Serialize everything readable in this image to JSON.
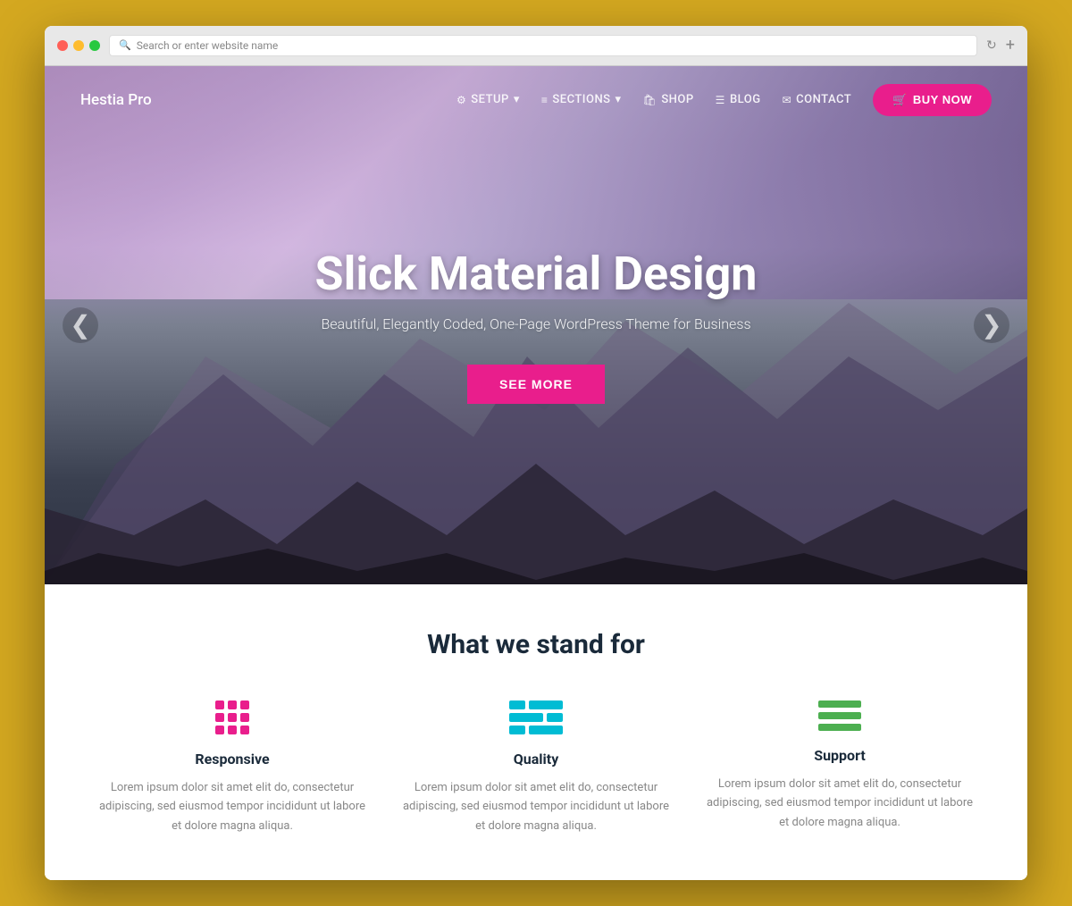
{
  "browser": {
    "address_placeholder": "Search or enter website name",
    "add_tab_label": "+"
  },
  "navbar": {
    "brand": "Hestia Pro",
    "nav_items": [
      {
        "id": "setup",
        "label": "SETUP",
        "icon": "⚙",
        "has_dropdown": true
      },
      {
        "id": "sections",
        "label": "SECTIONS",
        "icon": "≡",
        "has_dropdown": true
      },
      {
        "id": "shop",
        "label": "SHOP",
        "icon": "🛍"
      },
      {
        "id": "blog",
        "label": "BLOG",
        "icon": "≡"
      },
      {
        "id": "contact",
        "label": "CONTACT",
        "icon": "✉"
      }
    ],
    "buy_now_label": "BUY NOW"
  },
  "hero": {
    "title": "Slick Material Design",
    "subtitle": "Beautiful, Elegantly Coded, One-Page WordPress Theme for Business",
    "cta_label": "SEE MORE",
    "arrow_left": "❮",
    "arrow_right": "❯"
  },
  "features": {
    "section_title": "What we stand for",
    "items": [
      {
        "id": "responsive",
        "name": "Responsive",
        "description": "Lorem ipsum dolor sit amet elit do, consectetur adipiscing, sed eiusmod tempor incididunt ut labore et dolore magna aliqua.",
        "icon_type": "grid",
        "icon_color": "#e91e8c"
      },
      {
        "id": "quality",
        "name": "Quality",
        "description": "Lorem ipsum dolor sit amet elit do, consectetur adipiscing, sed eiusmod tempor incididunt ut labore et dolore magna aliqua.",
        "icon_type": "layout",
        "icon_color": "#00bcd4"
      },
      {
        "id": "support",
        "name": "Support",
        "description": "Lorem ipsum dolor sit amet elit do, consectetur adipiscing, sed eiusmod tempor incididunt ut labore et dolore magna aliqua.",
        "icon_type": "lines",
        "icon_color": "#4caf50"
      }
    ]
  },
  "colors": {
    "primary_pink": "#e91e8c",
    "teal": "#00bcd4",
    "green": "#4caf50",
    "dark_text": "#1a2a3a"
  }
}
